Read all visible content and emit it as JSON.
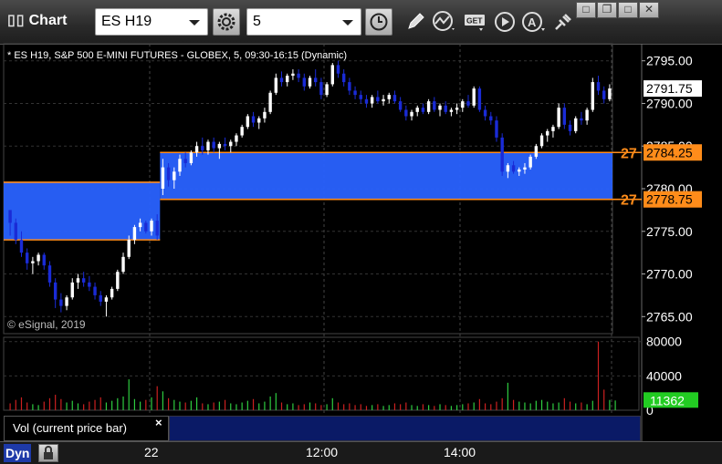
{
  "window": {
    "title": "Chart",
    "symbol": "ES H19",
    "interval": "5",
    "buttons": [
      "minimize-icon",
      "restore-icon",
      "close-icon"
    ]
  },
  "toolbar": {
    "icons": [
      "settings-gear-icon",
      "clock-icon",
      "pencil-icon",
      "line-study-icon",
      "get-data-icon",
      "play-icon",
      "alert-icon",
      "link-icon"
    ]
  },
  "chart": {
    "header": "* ES H19, S&P 500 E-MINI FUTURES - GLOBEX, 5, 09:30-16:15 (Dynamic)",
    "copyright": "© eSignal, 2019",
    "price_labels": [
      "2795.00",
      "2790.00",
      "2785.00",
      "2780.00",
      "2775.00",
      "2770.00",
      "2765.00"
    ],
    "last_price": "2791.75",
    "zone_upper_label": "2784.25",
    "zone_lower_label": "2778.75",
    "zone_prefix": "27",
    "vol_labels": [
      "80000",
      "40000",
      "0"
    ],
    "vol_last": "11362",
    "vol_title": "Vol (current price bar)",
    "time_labels": [
      "22",
      "12:00",
      "14:00"
    ],
    "dyn_label": "Dyn",
    "colors": {
      "zone_fill": "#2962ff",
      "zone_line": "#ff8c1a",
      "up_candle": "#ffffff",
      "down_candle": "#1a2bd6",
      "vol_up": "#2ecc40",
      "vol_down": "#cc2020",
      "last_price_bg": "#ffffff",
      "vol_last_bg": "#22cc22"
    }
  },
  "chart_data": {
    "type": "candlestick",
    "y_range": [
      2763,
      2797
    ],
    "vol_range": [
      0,
      85000
    ],
    "zones": [
      {
        "start_bar": 0,
        "end_bar": 26,
        "high": 2780.75,
        "low": 2774.0
      },
      {
        "start_bar": 27,
        "end_bar": 110,
        "high": 2784.25,
        "low": 2778.75
      }
    ],
    "candles": [
      [
        2777.5,
        2777.25,
        2774.5,
        2776.0
      ],
      [
        2776.0,
        2776.5,
        2773.5,
        2774.0
      ],
      [
        2774.0,
        2775.0,
        2772.0,
        2772.5
      ],
      [
        2772.5,
        2773.0,
        2770.5,
        2771.25
      ],
      [
        2771.25,
        2772.0,
        2770.0,
        2771.5
      ],
      [
        2771.5,
        2772.5,
        2771.0,
        2772.25
      ],
      [
        2772.25,
        2772.5,
        2770.5,
        2771.0
      ],
      [
        2771.0,
        2771.5,
        2768.5,
        2769.0
      ],
      [
        2769.0,
        2769.5,
        2766.0,
        2767.0
      ],
      [
        2767.0,
        2767.75,
        2765.5,
        2766.25
      ],
      [
        2766.25,
        2767.5,
        2765.75,
        2767.25
      ],
      [
        2767.25,
        2769.5,
        2767.0,
        2769.0
      ],
      [
        2769.0,
        2770.0,
        2768.25,
        2769.5
      ],
      [
        2769.5,
        2770.25,
        2768.5,
        2769.0
      ],
      [
        2769.0,
        2769.75,
        2768.0,
        2768.5
      ],
      [
        2768.5,
        2769.0,
        2767.0,
        2767.5
      ],
      [
        2767.5,
        2768.0,
        2766.25,
        2766.75
      ],
      [
        2766.75,
        2767.5,
        2765.0,
        2767.25
      ],
      [
        2767.25,
        2768.5,
        2767.0,
        2768.25
      ],
      [
        2768.25,
        2770.5,
        2768.0,
        2770.25
      ],
      [
        2770.25,
        2772.5,
        2770.0,
        2772.0
      ],
      [
        2772.0,
        2774.5,
        2771.75,
        2774.0
      ],
      [
        2774.0,
        2775.75,
        2773.5,
        2775.5
      ],
      [
        2775.5,
        2776.5,
        2775.0,
        2776.0
      ],
      [
        2776.0,
        2776.25,
        2774.75,
        2775.0
      ],
      [
        2775.0,
        2776.5,
        2774.5,
        2776.25
      ],
      [
        2776.25,
        2777.0,
        2774.0,
        2774.5
      ],
      [
        2780.0,
        2783.5,
        2779.25,
        2782.5
      ],
      [
        2782.5,
        2783.0,
        2780.25,
        2781.0
      ],
      [
        2781.0,
        2782.5,
        2780.0,
        2782.0
      ],
      [
        2782.0,
        2784.0,
        2781.5,
        2783.5
      ],
      [
        2783.5,
        2784.25,
        2782.5,
        2783.0
      ],
      [
        2783.0,
        2784.5,
        2782.75,
        2784.25
      ],
      [
        2784.25,
        2785.5,
        2783.75,
        2785.0
      ],
      [
        2785.0,
        2786.0,
        2784.0,
        2784.5
      ],
      [
        2784.5,
        2785.75,
        2784.0,
        2785.5
      ],
      [
        2785.5,
        2786.0,
        2784.25,
        2784.75
      ],
      [
        2784.75,
        2785.5,
        2783.5,
        2785.25
      ],
      [
        2785.25,
        2786.0,
        2784.5,
        2785.0
      ],
      [
        2785.0,
        2785.75,
        2784.25,
        2785.5
      ],
      [
        2785.5,
        2786.5,
        2785.0,
        2786.25
      ],
      [
        2786.25,
        2787.5,
        2786.0,
        2787.25
      ],
      [
        2787.25,
        2788.75,
        2787.0,
        2788.5
      ],
      [
        2788.5,
        2789.0,
        2787.25,
        2787.75
      ],
      [
        2787.75,
        2788.5,
        2787.0,
        2788.25
      ],
      [
        2788.25,
        2789.5,
        2787.75,
        2789.0
      ],
      [
        2789.0,
        2791.5,
        2788.75,
        2791.25
      ],
      [
        2791.25,
        2793.5,
        2791.0,
        2793.0
      ],
      [
        2793.0,
        2793.75,
        2792.0,
        2792.5
      ],
      [
        2792.5,
        2793.5,
        2792.0,
        2793.25
      ],
      [
        2793.25,
        2794.0,
        2792.75,
        2793.5
      ],
      [
        2793.5,
        2794.0,
        2792.5,
        2793.0
      ],
      [
        2793.0,
        2793.5,
        2791.5,
        2792.0
      ],
      [
        2792.0,
        2793.25,
        2791.75,
        2793.0
      ],
      [
        2793.0,
        2794.0,
        2792.0,
        2792.5
      ],
      [
        2792.5,
        2793.0,
        2790.5,
        2791.0
      ],
      [
        2791.0,
        2792.5,
        2790.75,
        2792.25
      ],
      [
        2792.25,
        2794.75,
        2792.0,
        2794.5
      ],
      [
        2794.5,
        2795.0,
        2793.0,
        2793.5
      ],
      [
        2793.5,
        2794.0,
        2792.0,
        2792.5
      ],
      [
        2792.5,
        2793.0,
        2791.0,
        2791.5
      ],
      [
        2791.5,
        2792.0,
        2790.5,
        2791.0
      ],
      [
        2791.0,
        2791.5,
        2790.0,
        2790.5
      ],
      [
        2790.5,
        2791.0,
        2789.5,
        2790.0
      ],
      [
        2790.0,
        2791.0,
        2789.5,
        2790.75
      ],
      [
        2790.75,
        2791.5,
        2790.0,
        2790.25
      ],
      [
        2790.25,
        2791.0,
        2789.75,
        2790.5
      ],
      [
        2790.5,
        2791.25,
        2790.0,
        2791.0
      ],
      [
        2791.0,
        2791.5,
        2790.0,
        2790.25
      ],
      [
        2790.25,
        2790.75,
        2789.0,
        2789.25
      ],
      [
        2789.25,
        2789.75,
        2788.0,
        2788.5
      ],
      [
        2788.5,
        2789.25,
        2788.0,
        2789.0
      ],
      [
        2789.0,
        2789.75,
        2788.5,
        2789.5
      ],
      [
        2789.5,
        2790.0,
        2788.75,
        2789.0
      ],
      [
        2789.0,
        2790.5,
        2788.75,
        2790.25
      ],
      [
        2790.25,
        2790.75,
        2789.0,
        2789.25
      ],
      [
        2789.25,
        2790.0,
        2788.5,
        2789.75
      ],
      [
        2789.75,
        2790.25,
        2788.75,
        2789.0
      ],
      [
        2789.0,
        2789.5,
        2788.5,
        2789.25
      ],
      [
        2789.25,
        2790.0,
        2788.75,
        2789.5
      ],
      [
        2789.5,
        2790.5,
        2789.0,
        2790.25
      ],
      [
        2790.25,
        2791.0,
        2789.5,
        2789.75
      ],
      [
        2789.75,
        2792.0,
        2789.5,
        2791.75
      ],
      [
        2791.75,
        2792.0,
        2789.0,
        2789.25
      ],
      [
        2789.25,
        2789.75,
        2788.0,
        2788.5
      ],
      [
        2788.5,
        2789.0,
        2787.5,
        2788.0
      ],
      [
        2788.0,
        2788.5,
        2785.5,
        2786.0
      ],
      [
        2786.0,
        2786.5,
        2781.5,
        2782.0
      ],
      [
        2782.0,
        2783.0,
        2781.25,
        2782.75
      ],
      [
        2782.75,
        2783.25,
        2781.75,
        2782.0
      ],
      [
        2782.0,
        2782.5,
        2781.5,
        2782.25
      ],
      [
        2782.25,
        2783.0,
        2781.75,
        2782.5
      ],
      [
        2782.5,
        2784.0,
        2782.25,
        2783.75
      ],
      [
        2783.75,
        2785.25,
        2783.5,
        2785.0
      ],
      [
        2785.0,
        2786.5,
        2784.75,
        2786.25
      ],
      [
        2786.25,
        2787.0,
        2785.5,
        2786.75
      ],
      [
        2786.75,
        2787.5,
        2786.0,
        2787.25
      ],
      [
        2787.25,
        2790.0,
        2787.0,
        2789.5
      ],
      [
        2789.5,
        2790.0,
        2787.0,
        2787.5
      ],
      [
        2787.5,
        2788.0,
        2786.25,
        2786.75
      ],
      [
        2786.75,
        2788.5,
        2786.5,
        2788.25
      ],
      [
        2788.25,
        2789.0,
        2787.5,
        2788.0
      ],
      [
        2788.0,
        2789.5,
        2787.5,
        2789.25
      ],
      [
        2789.25,
        2793.0,
        2789.0,
        2792.5
      ],
      [
        2792.5,
        2793.25,
        2791.0,
        2791.5
      ],
      [
        2791.5,
        2792.0,
        2790.0,
        2790.5
      ],
      [
        2790.5,
        2792.25,
        2790.25,
        2791.75
      ]
    ],
    "volumes": [
      8000,
      12000,
      15000,
      9000,
      7000,
      6000,
      10000,
      14000,
      18000,
      13000,
      9000,
      11000,
      8000,
      7000,
      10000,
      12000,
      15000,
      9000,
      11000,
      14000,
      16000,
      36000,
      13000,
      10000,
      12000,
      15000,
      28000,
      22000,
      14000,
      12000,
      10000,
      9000,
      11000,
      15000,
      8000,
      7000,
      9000,
      10000,
      12000,
      8000,
      7000,
      9000,
      11000,
      13000,
      8000,
      10000,
      16000,
      20000,
      9000,
      7000,
      8000,
      6000,
      7000,
      9000,
      8000,
      6000,
      7000,
      14000,
      9000,
      7000,
      8000,
      6000,
      7000,
      5000,
      6000,
      7000,
      5000,
      6000,
      8000,
      7000,
      9000,
      6000,
      5000,
      7000,
      6000,
      5000,
      7000,
      6000,
      5000,
      6000,
      7000,
      8000,
      9000,
      13000,
      8000,
      7000,
      10000,
      14000,
      32000,
      12000,
      10000,
      9000,
      8000,
      11000,
      12000,
      10000,
      8000,
      9000,
      14000,
      10000,
      8000,
      9000,
      7000,
      11000,
      80000,
      24000,
      12000,
      11362
    ]
  }
}
